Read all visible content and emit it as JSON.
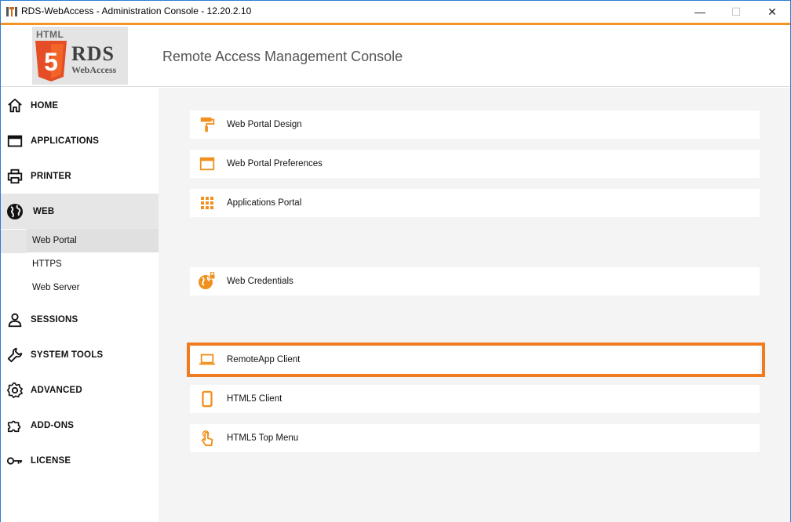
{
  "window": {
    "title": "RDS-WebAccess - Administration Console - 12.20.2.10",
    "minimize_glyph": "—",
    "maximize_glyph": "☐",
    "close_glyph": "✕"
  },
  "header": {
    "logo_html": "HTML",
    "logo_five": "5",
    "logo_rds": "RDS",
    "logo_webaccess": "WebAccess",
    "console_title": "Remote Access Management Console"
  },
  "colors": {
    "accent": "#f39423",
    "highlight": "#f07c21",
    "icon_orange": "#f0901e"
  },
  "sidebar": {
    "items": [
      {
        "label": "HOME",
        "icon": "home-icon"
      },
      {
        "label": "APPLICATIONS",
        "icon": "window-icon"
      },
      {
        "label": "PRINTER",
        "icon": "printer-icon"
      },
      {
        "label": "WEB",
        "icon": "globe-icon",
        "active": true
      },
      {
        "label": "SESSIONS",
        "icon": "user-icon"
      },
      {
        "label": "SYSTEM TOOLS",
        "icon": "wrench-icon"
      },
      {
        "label": "ADVANCED",
        "icon": "gear-icon"
      },
      {
        "label": "ADD-ONS",
        "icon": "puzzle-icon"
      },
      {
        "label": "LICENSE",
        "icon": "key-icon"
      }
    ],
    "web_subitems": [
      {
        "label": "Web Portal",
        "active": true
      },
      {
        "label": "HTTPS"
      },
      {
        "label": "Web Server"
      }
    ]
  },
  "main": {
    "cards": [
      {
        "label": "Web Portal Design",
        "icon": "paint-roller-icon"
      },
      {
        "label": "Web Portal Preferences",
        "icon": "window-icon"
      },
      {
        "label": "Applications Portal",
        "icon": "grid-icon"
      },
      {
        "label": "Web Credentials",
        "icon": "globe-lock-icon"
      },
      {
        "label": "RemoteApp Client",
        "icon": "laptop-icon",
        "highlighted": true
      },
      {
        "label": "HTML5 Client",
        "icon": "mobile-icon"
      },
      {
        "label": "HTML5 Top Menu",
        "icon": "touch-icon"
      }
    ]
  }
}
